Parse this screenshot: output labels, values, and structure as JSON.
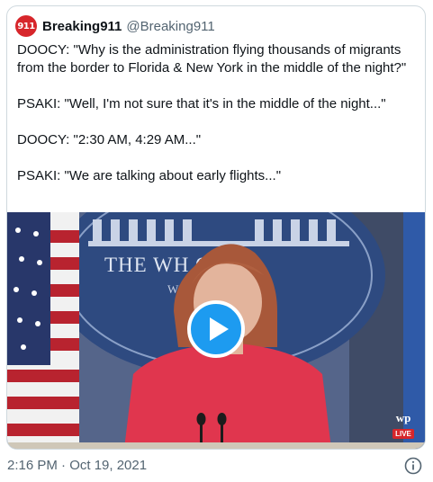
{
  "tweet": {
    "avatar_text": "911",
    "display_name": "Breaking911",
    "handle": "@Breaking911",
    "paragraphs": [
      "DOOCY: \"Why is the administration flying thousands of migrants from the border to Florida & New York in the middle of the night?\"",
      "PSAKI: \"Well, I'm not sure that it's in the middle of the night...\"",
      "DOOCY: \"2:30 AM, 4:29 AM...\"",
      "PSAKI: \"We are talking about early flights...\""
    ],
    "timestamp": "2:16 PM · Oct 19, 2021"
  },
  "media": {
    "seal_text": "THE WH     OUSE",
    "seal_subtext": "WA",
    "watermark_logo": "wp",
    "watermark_live": "LIVE"
  },
  "icons": {
    "play": "play-icon",
    "info": "info-icon"
  },
  "colors": {
    "accent": "#1d9bf0",
    "border": "#cfd9de",
    "secondary_text": "#536471",
    "avatar_bg": "#d7262b"
  }
}
